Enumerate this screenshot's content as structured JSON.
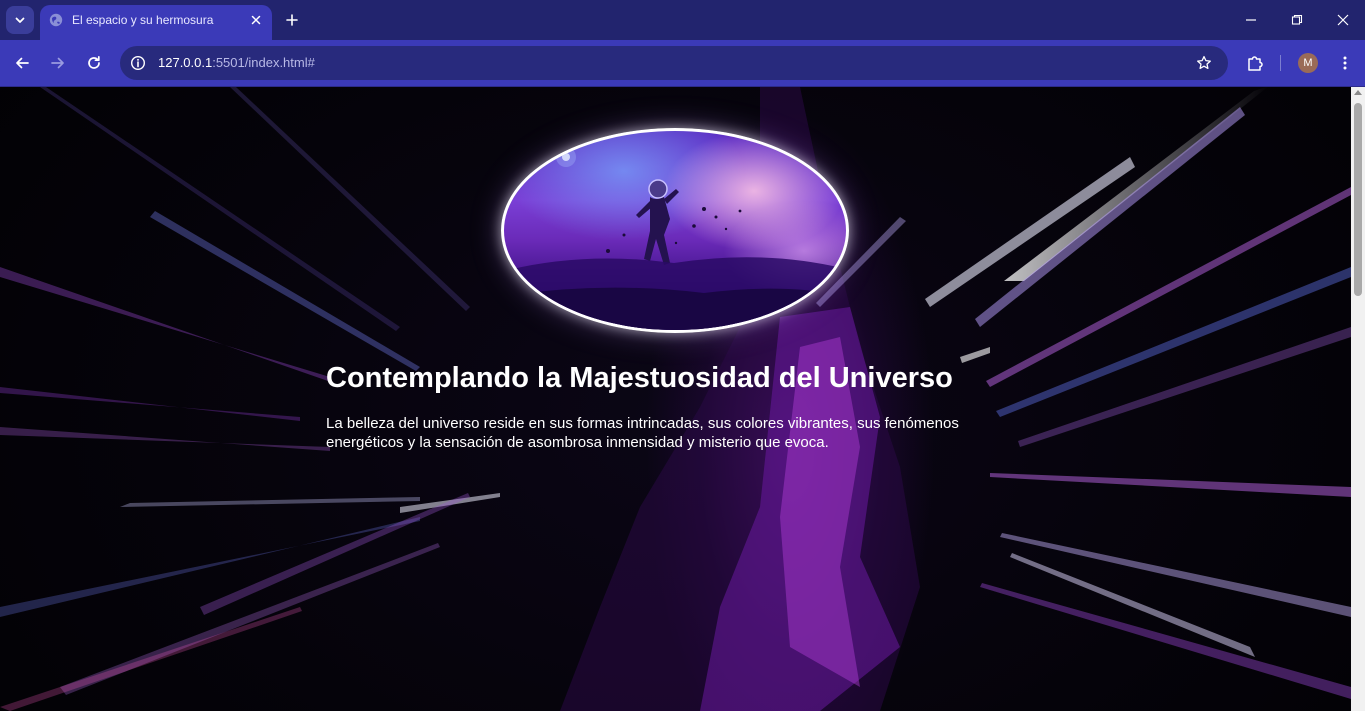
{
  "browser": {
    "tab_title": "El espacio y su hermosura",
    "url_host": "127.0.0.1",
    "url_rest": ":5501/index.html#",
    "profile_initial": "M"
  },
  "page": {
    "heading": "Contemplando la Majestuosidad del Universo",
    "paragraph": "La belleza del universo reside en sus formas intrincadas, sus colores vibrantes, sus fenómenos energéticos y la sensación de asombrosa inmensidad y misterio que evoca."
  },
  "icons": {
    "tab_search": "chevron-down-icon",
    "favicon": "globe-icon",
    "tab_close": "close-icon",
    "new_tab": "plus-icon",
    "minimize": "minimize-icon",
    "restore": "restore-icon",
    "close_window": "close-icon",
    "back": "arrow-left-icon",
    "forward": "arrow-right-icon",
    "reload": "reload-icon",
    "site_info": "info-icon",
    "bookmark": "star-icon",
    "extensions": "puzzle-icon",
    "menu": "kebab-menu-icon"
  },
  "colors": {
    "titlebar": "#22246e",
    "toolbar": "#3b3ab8",
    "omnibox": "#282a7d",
    "page_background": "#05030a",
    "accent_purple": "#7a3fd6"
  }
}
